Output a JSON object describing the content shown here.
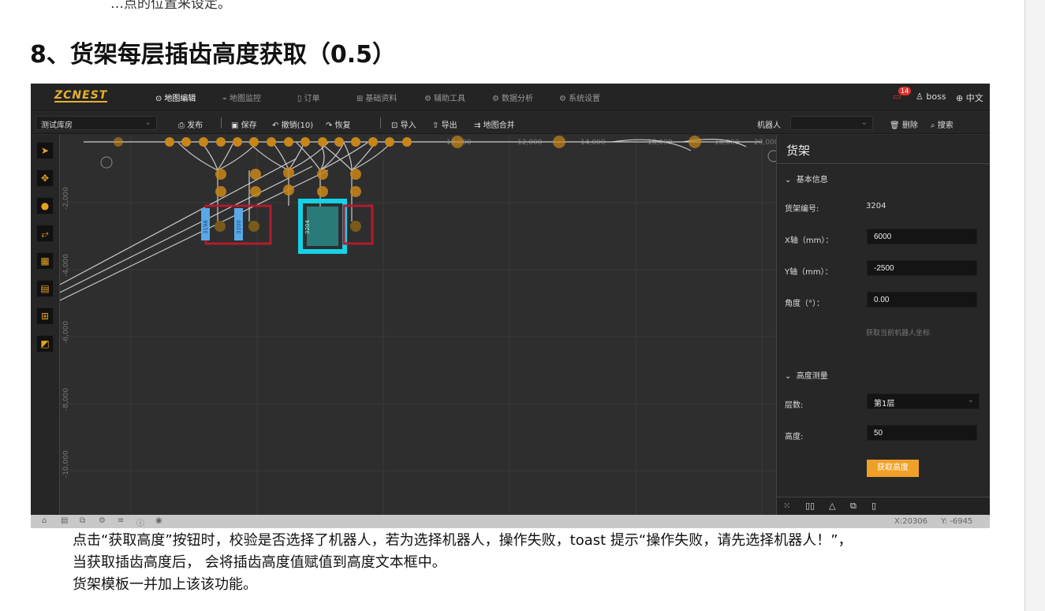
{
  "doc": {
    "top_text": "…点的位置来设定。",
    "heading": "8、货架每层插齿高度获取（0.5）",
    "paragraph": [
      "点击“获取高度”按钮时，校验是否选择了机器人，若为选择机器人，操作失败，toast 提示“操作失败，请先选择机器人！”，",
      "当获取插齿高度后， 会将插齿高度值赋值到高度文本框中。",
      "货架模板一并加上该该功能。"
    ]
  },
  "app": {
    "logo": "ZCNEST",
    "nav": [
      {
        "icon": "map-pin-icon",
        "glyph": "⊙",
        "label": "地图编辑",
        "active": true
      },
      {
        "icon": "chart-icon",
        "glyph": "⌁",
        "label": "地图监控",
        "active": false
      },
      {
        "icon": "doc-icon",
        "glyph": "▯",
        "label": "订单",
        "active": false
      },
      {
        "icon": "grid-icon",
        "glyph": "⊞",
        "label": "基础资料",
        "active": false
      },
      {
        "icon": "gear-icon",
        "glyph": "⚙",
        "label": "辅助工具",
        "active": false
      },
      {
        "icon": "gear-icon",
        "glyph": "⚙",
        "label": "数据分析",
        "active": false
      },
      {
        "icon": "gear-icon",
        "glyph": "⚙",
        "label": "系统设置",
        "active": false
      }
    ],
    "notif_count": "14",
    "user": "boss",
    "language": "中文",
    "toolbar": {
      "warehouse": "测试库房",
      "publish": "发布",
      "save": "保存",
      "undo": "撤销(10)",
      "redo": "恢复",
      "import": "导入",
      "export": "导出",
      "merge": "地图合并",
      "robot_label": "机器人",
      "delete": "删除",
      "search": "搜索"
    },
    "canvas": {
      "x_ticks": [
        "10,000",
        "12,000",
        "14,000",
        "16,000",
        "18,000",
        "20,000"
      ],
      "y_ticks": [
        "-2,000",
        "-4,000",
        "-6,000",
        "-8,000",
        "-10,000"
      ],
      "rack_labels": [
        "3198",
        "3200",
        "3204"
      ]
    },
    "panel": {
      "title": "货架",
      "basic_section": "基本信息",
      "rack_no_label": "货架编号:",
      "rack_no": "3204",
      "x_label": "X轴（mm）：",
      "x_value": "6000",
      "y_label": "Y轴（mm）：",
      "y_value": "-2500",
      "angle_label": "角度（°）：",
      "angle_value": "0.00",
      "get_robot_coord": "获取当前机器人坐标",
      "height_section": "高度测量",
      "layer_label": "层数:",
      "layer_value": "第1层",
      "height_label": "高度:",
      "height_value": "50",
      "get_height_button": "获取高度"
    },
    "status": {
      "x": "X:20306",
      "y": "Y: -6945"
    }
  }
}
